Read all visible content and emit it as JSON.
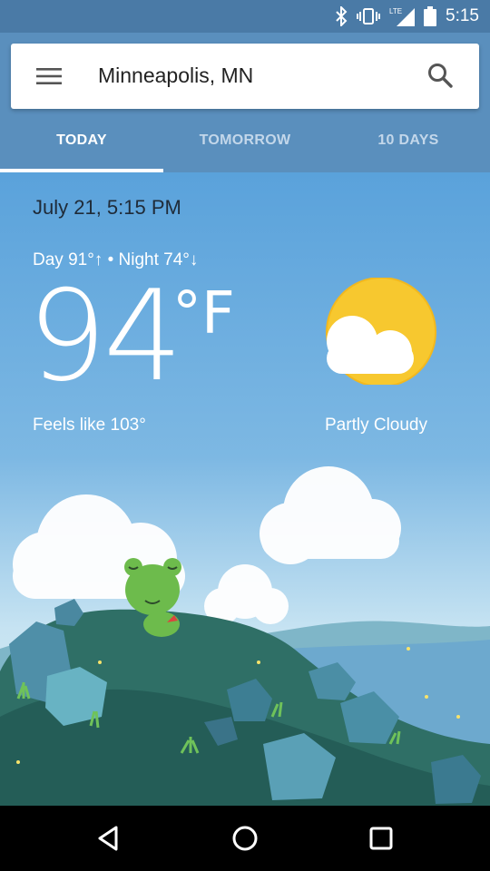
{
  "status": {
    "time": "5:15",
    "network": "LTE"
  },
  "search": {
    "location": "Minneapolis, MN"
  },
  "tabs": [
    "TODAY",
    "TOMORROW",
    "10 DAYS"
  ],
  "weather": {
    "datetime": "July 21, 5:15 PM",
    "day_night": "Day 91°↑ • Night 74°↓",
    "temperature": "94",
    "unit": "°F",
    "feels_like": "Feels like 103°",
    "condition": "Partly Cloudy"
  },
  "icons": {
    "menu": "menu-icon",
    "search": "search-icon",
    "bluetooth": "bluetooth-icon",
    "vibrate": "vibrate-icon",
    "signal": "signal-icon",
    "battery": "battery-icon",
    "weather": "partly-cloudy-icon",
    "back": "back-icon",
    "home": "home-icon",
    "recents": "recents-icon"
  },
  "colors": {
    "statusbar": "#4a7aa6",
    "appbar": "#5a8fbd",
    "sky_top": "#5aa2db",
    "sun": "#f7c82f"
  }
}
